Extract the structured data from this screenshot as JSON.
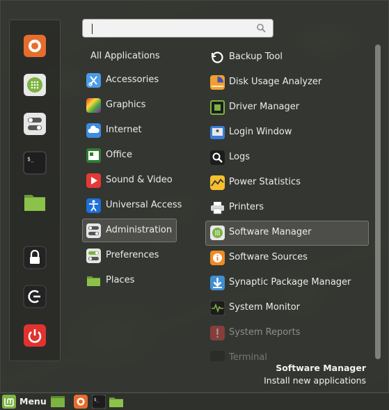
{
  "search": {
    "value": "",
    "placeholder": ""
  },
  "favorites": [
    {
      "name": "firefox-icon",
      "color": "#e66d2d"
    },
    {
      "name": "software-manager-icon",
      "color": "#7cb342"
    },
    {
      "name": "settings-toggle-icon",
      "color": "#e6e6e6"
    },
    {
      "name": "terminal-icon",
      "color": "#1e1e1e"
    },
    {
      "name": "folder-icon",
      "color": "#7cb342"
    },
    {
      "name": "lock-icon",
      "color": "#232323"
    },
    {
      "name": "logout-icon",
      "color": "#232323"
    },
    {
      "name": "shutdown-icon",
      "color": "#e0332f"
    }
  ],
  "categories": {
    "all": "All Applications",
    "items": [
      {
        "label": "Accessories",
        "icon": "accessories-icon"
      },
      {
        "label": "Graphics",
        "icon": "graphics-icon"
      },
      {
        "label": "Internet",
        "icon": "internet-icon"
      },
      {
        "label": "Office",
        "icon": "office-icon"
      },
      {
        "label": "Sound & Video",
        "icon": "sound-video-icon"
      },
      {
        "label": "Universal Access",
        "icon": "universal-access-icon"
      },
      {
        "label": "Administration",
        "icon": "administration-icon"
      },
      {
        "label": "Preferences",
        "icon": "preferences-icon"
      },
      {
        "label": "Places",
        "icon": "places-icon"
      }
    ],
    "selected": "Administration"
  },
  "apps": [
    {
      "label": "Backup Tool",
      "icon": "backup-tool-icon"
    },
    {
      "label": "Disk Usage Analyzer",
      "icon": "disk-usage-icon"
    },
    {
      "label": "Driver Manager",
      "icon": "driver-manager-icon"
    },
    {
      "label": "Login Window",
      "icon": "login-window-icon"
    },
    {
      "label": "Logs",
      "icon": "logs-icon"
    },
    {
      "label": "Power Statistics",
      "icon": "power-statistics-icon"
    },
    {
      "label": "Printers",
      "icon": "printers-icon"
    },
    {
      "label": "Software Manager",
      "icon": "software-manager-icon"
    },
    {
      "label": "Software Sources",
      "icon": "software-sources-icon"
    },
    {
      "label": "Synaptic Package Manager",
      "icon": "synaptic-icon"
    },
    {
      "label": "System Monitor",
      "icon": "system-monitor-icon"
    },
    {
      "label": "System Reports",
      "icon": "system-reports-icon"
    },
    {
      "label": "Terminal",
      "icon": "terminal-icon"
    }
  ],
  "selected_app": "Software Manager",
  "app_info": {
    "name": "Software Manager",
    "description": "Install new applications"
  },
  "taskbar": {
    "menu_label": "Menu",
    "launchers": [
      "desktop-icon",
      "firefox-icon",
      "terminal-icon",
      "files-icon"
    ]
  },
  "colors": {
    "accent_green": "#7cb342",
    "panel_bg": "#343632",
    "selection_bg": "#50504c"
  }
}
